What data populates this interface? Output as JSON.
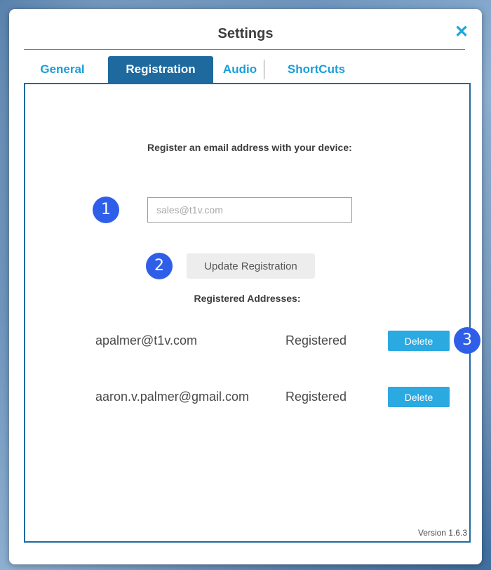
{
  "dialog": {
    "title": "Settings",
    "close_icon": "close-icon"
  },
  "tabs": [
    {
      "label": "General",
      "active": false
    },
    {
      "label": "Registration",
      "active": true
    },
    {
      "label": "Audio",
      "active": false
    },
    {
      "label": "ShortCuts",
      "active": false
    }
  ],
  "registration": {
    "prompt": "Register an email address with your device:",
    "email_placeholder": "sales@t1v.com",
    "update_button": "Update Registration",
    "registered_heading": "Registered Addresses:",
    "addresses": [
      {
        "email": "apalmer@t1v.com",
        "status": "Registered",
        "action": "Delete"
      },
      {
        "email": "aaron.v.palmer@gmail.com",
        "status": "Registered",
        "action": "Delete"
      }
    ]
  },
  "callouts": [
    "1",
    "2",
    "3"
  ],
  "version": "Version 1.6.3",
  "colors": {
    "accent": "#1b9ed8",
    "active_tab": "#1e6a9e",
    "callout": "#2f5fe8",
    "delete_button": "#2ba9e1"
  }
}
